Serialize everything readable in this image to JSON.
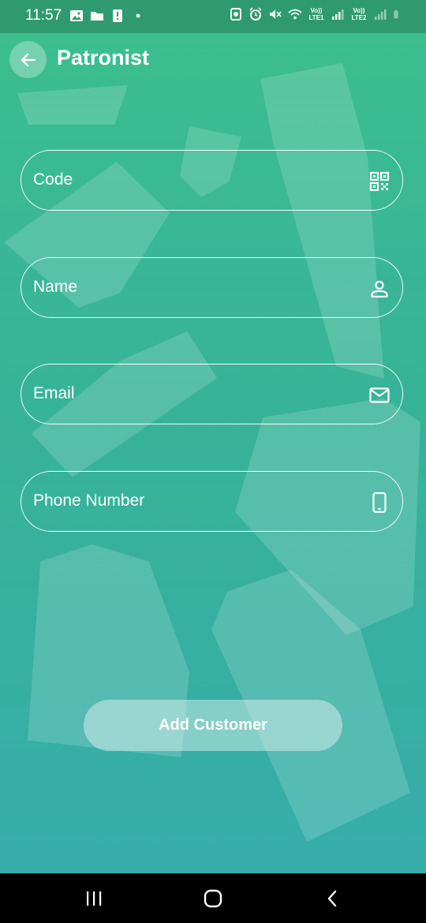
{
  "status_bar": {
    "time": "11:57",
    "lte1": "Vo)) LTE1",
    "lte2": "Vo)) LTE2",
    "left_icons": [
      "image-icon",
      "folder-icon",
      "alert-icon",
      "dot-icon"
    ],
    "right_icons": [
      "sync-icon",
      "alarm-icon",
      "mute-icon",
      "wifi-icon",
      "signal-icon",
      "signal-icon",
      "battery-icon"
    ]
  },
  "app_bar": {
    "title": "Patronist",
    "back_icon": "arrow-left-icon"
  },
  "form": {
    "code": {
      "label": "Code",
      "icon": "qr-code-icon"
    },
    "name": {
      "label": "Name",
      "icon": "person-icon"
    },
    "email": {
      "label": "Email",
      "icon": "mail-icon"
    },
    "phone": {
      "label": "Phone Number",
      "icon": "phone-icon"
    },
    "submit_label": "Add Customer"
  },
  "nav_bar": {
    "icons": [
      "recent-apps-icon",
      "home-icon",
      "back-icon"
    ]
  },
  "colors": {
    "gradient_top": "#3cbf8e",
    "gradient_bottom": "#36adaa",
    "status_bar": "#2f9a6f"
  }
}
